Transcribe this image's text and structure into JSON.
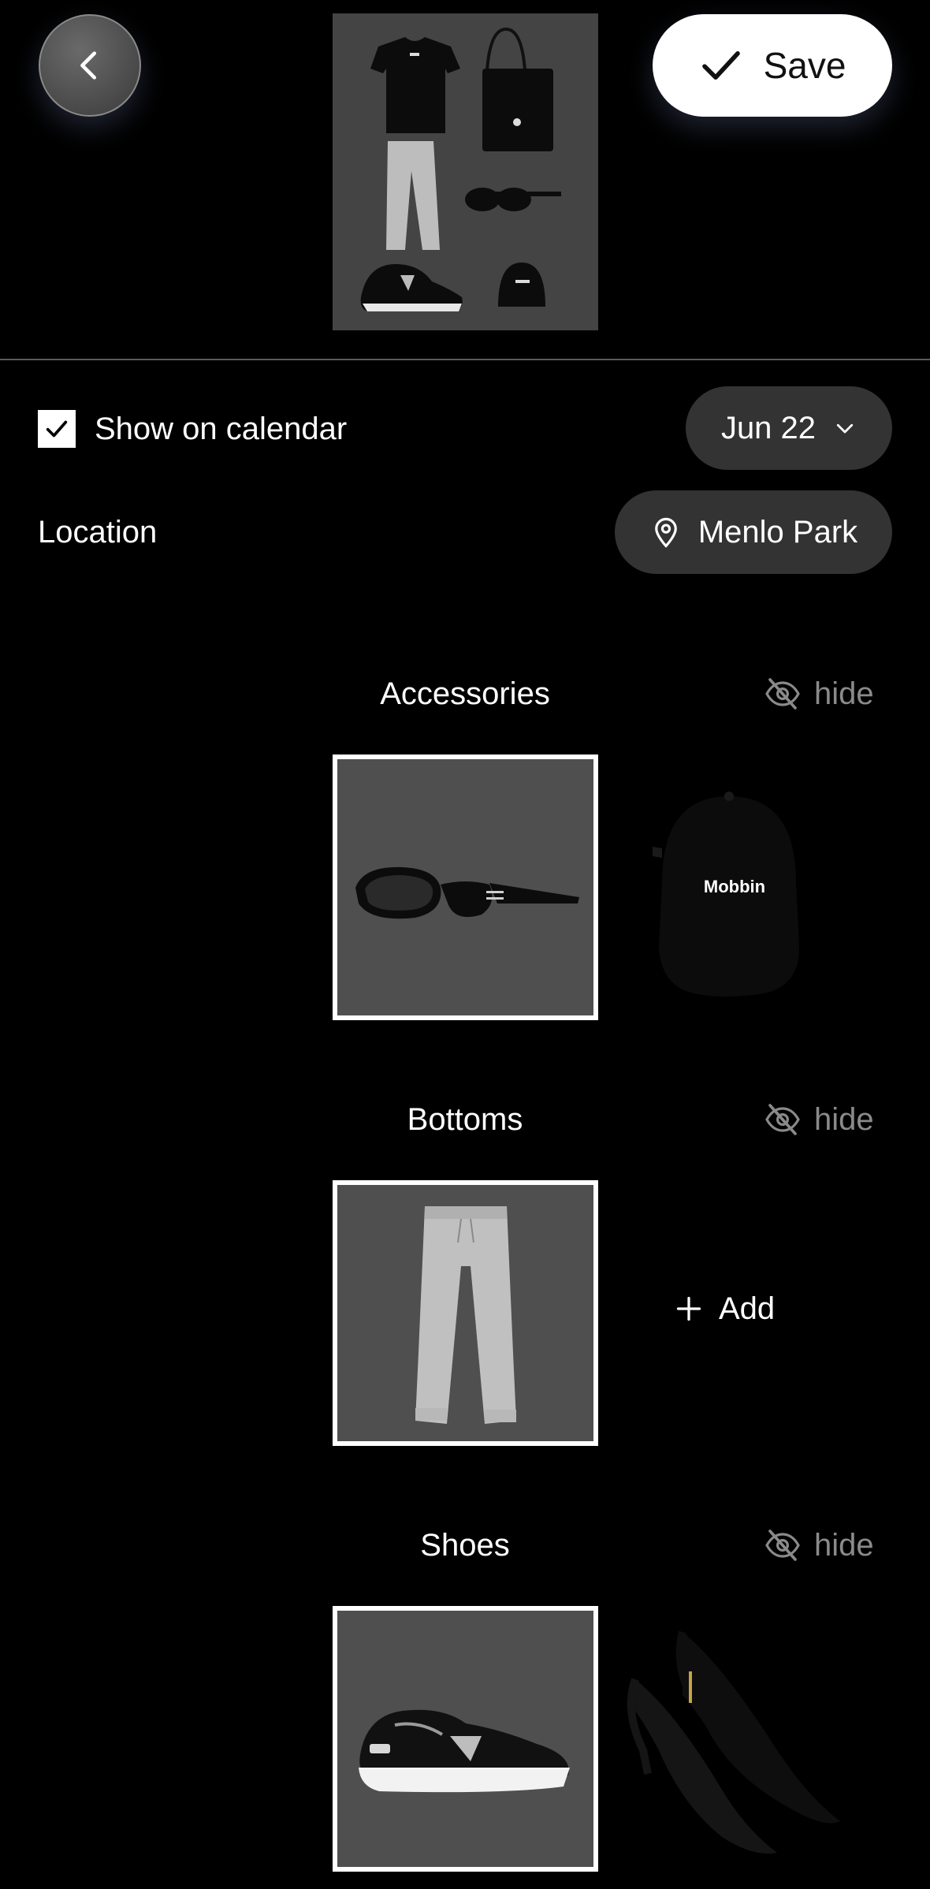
{
  "header": {
    "back_icon": "chevron-left-icon",
    "save_label": "Save",
    "save_icon": "checkmark-icon"
  },
  "calendar": {
    "show_label": "Show on calendar",
    "checked": true,
    "date": "Jun 22",
    "date_icon": "chevron-down-icon"
  },
  "location": {
    "label": "Location",
    "value": "Menlo Park",
    "icon": "map-pin-icon"
  },
  "sections": [
    {
      "title": "Accessories",
      "hide_label": "hide",
      "selected_item": "sunglasses",
      "other_items": [
        "cap"
      ],
      "cap_logo": "Mobbin"
    },
    {
      "title": "Bottoms",
      "hide_label": "hide",
      "selected_item": "sweatpants",
      "add_label": "Add"
    },
    {
      "title": "Shoes",
      "hide_label": "hide",
      "selected_item": "sneakers",
      "other_items": [
        "heels"
      ]
    }
  ],
  "colors": {
    "background": "#000000",
    "pill": "#333333",
    "card": "#4f4f4f",
    "muted": "#8a8a8a"
  }
}
